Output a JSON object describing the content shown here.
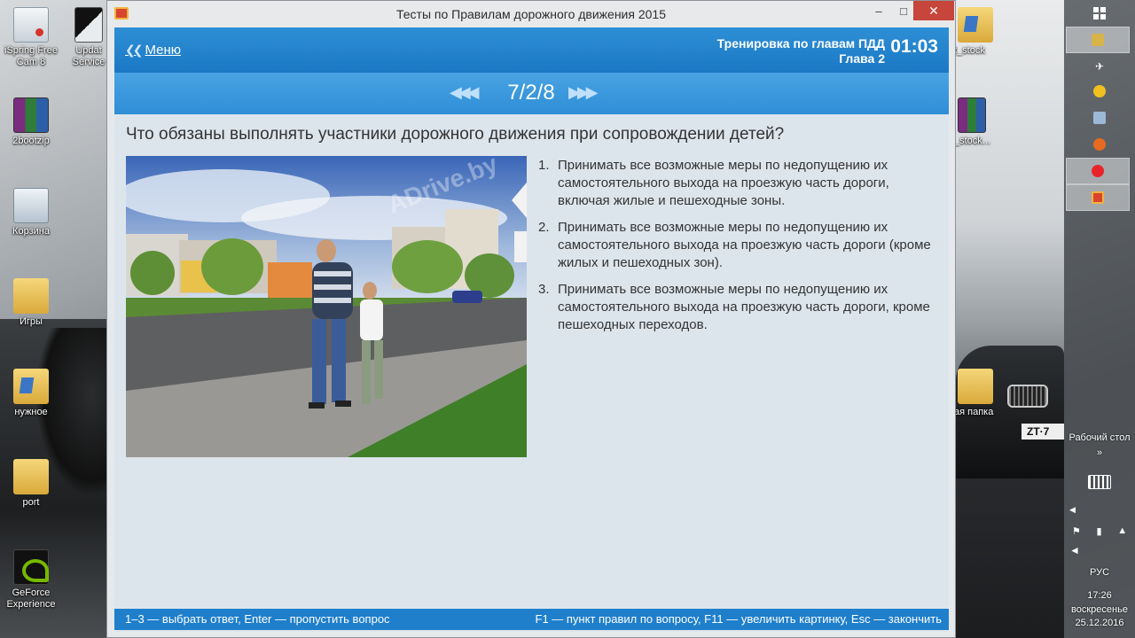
{
  "desktop": {
    "icons": [
      {
        "label": "iSpring Free Cam 8"
      },
      {
        "label": "2bootzip"
      },
      {
        "label": "Корзина"
      },
      {
        "label": "Игры"
      },
      {
        "label": "нужное"
      },
      {
        "label": "port"
      },
      {
        "label": "GeForce Experience"
      },
      {
        "label": "Updat Service"
      },
      {
        "label": "t_stock"
      },
      {
        "label": "_stock..."
      },
      {
        "label": "ая папка"
      }
    ],
    "car_plate": "ZT·7"
  },
  "window": {
    "title": "Тесты по Правилам дорожного движения 2015",
    "minimize": "–",
    "maximize": "□",
    "close": "✕"
  },
  "header": {
    "menu_label": "Меню",
    "mode_line1": "Тренировка по главам ПДД",
    "mode_line2": "Глава 2",
    "timer": "01:03"
  },
  "nav": {
    "counter": "7/2/8",
    "prev_icon": "double-chevron-left-icon",
    "next_icon": "double-chevron-right-icon"
  },
  "question": {
    "text": "Что обязаны выполнять участники дорожного движения при сопровождении детей?",
    "image_watermark": "ADrive.by",
    "answers": [
      {
        "num": "1.",
        "text": "Принимать все возможные меры по недопущению их самостоятельного выхода на проезжую часть дороги, включая жилые и пешеходные зоны."
      },
      {
        "num": "2.",
        "text": "Принимать все возможные меры по недопущению их самостоятельного выхода на проезжую часть дороги (кроме жилых и пешеходных зон)."
      },
      {
        "num": "3.",
        "text": "Принимать все возможные меры по недопущению их самостоятельного выхода на проезжую часть дороги, кроме пешеходных переходов."
      }
    ]
  },
  "footer": {
    "left": "1–3 — выбрать ответ, Enter — пропустить вопрос",
    "right": "F1 — пункт правил по вопросу, F11 — увеличить картинку, Esc — закончить"
  },
  "taskbar": {
    "desktop_label": "Рабочий стол",
    "expand": "»",
    "language": "РУС",
    "time": "17:26",
    "day": "воскресенье",
    "date": "25.12.2016"
  },
  "colors": {
    "header_blue": "#1a78c4",
    "nav_blue": "#3a98dc",
    "content_bg": "#dde5ec",
    "close_red": "#c7453a"
  }
}
